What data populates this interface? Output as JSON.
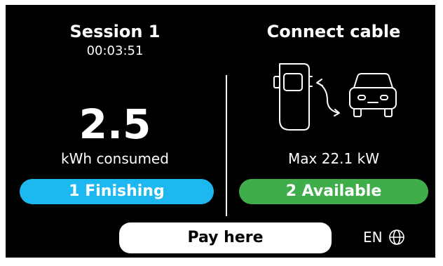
{
  "session": {
    "title": "Session 1",
    "elapsed": "00:03:51",
    "energy_value": "2.5",
    "energy_label": "kWh consumed",
    "status": "1 Finishing"
  },
  "connector": {
    "title": "Connect cable",
    "max_power": "Max 22.1 kW",
    "status": "2 Available"
  },
  "footer": {
    "pay_label": "Pay here",
    "language": "EN"
  },
  "icons": {
    "illustration": "charger-car-icon",
    "language": "globe-icon"
  },
  "colors": {
    "background": "#000000",
    "finishing": "#1eb8f0",
    "available": "#3fae4a",
    "pay_button": "#ffffff"
  }
}
